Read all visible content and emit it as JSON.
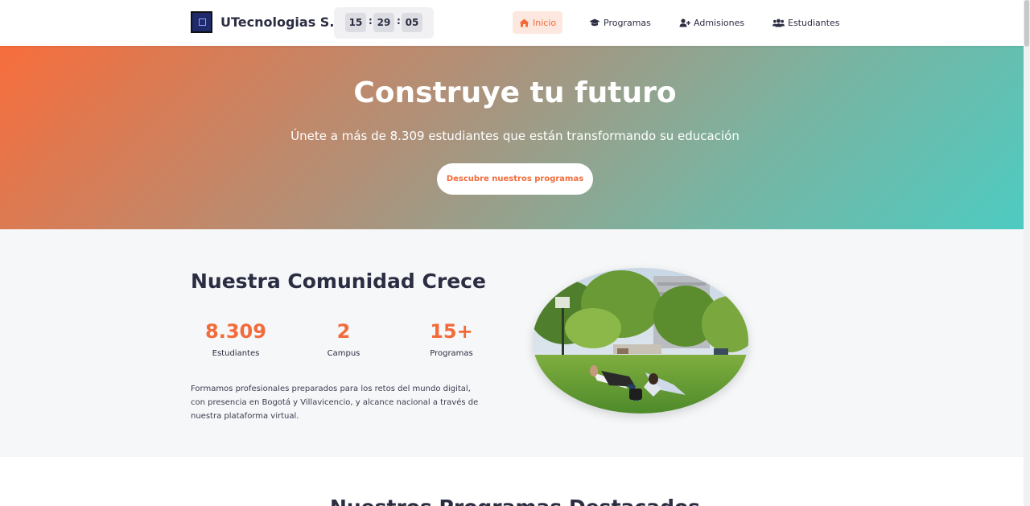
{
  "header": {
    "brand": "UTecnologias S.O",
    "clock": {
      "hours": "15",
      "minutes": "29",
      "seconds": "05",
      "separator": ":"
    },
    "nav": [
      {
        "label": "Inicio",
        "icon": "home-icon",
        "active": true
      },
      {
        "label": "Programas",
        "icon": "graduation-cap-icon",
        "active": false
      },
      {
        "label": "Admisiones",
        "icon": "user-plus-icon",
        "active": false
      },
      {
        "label": "Estudiantes",
        "icon": "users-icon",
        "active": false
      }
    ]
  },
  "hero": {
    "title": "Construye tu futuro",
    "subtitle": "Únete a más de 8.309 estudiantes que están transformando su educación",
    "cta": "Descubre nuestros programas"
  },
  "community": {
    "title": "Nuestra Comunidad Crece",
    "stats": [
      {
        "value": "8.309",
        "label": "Estudiantes"
      },
      {
        "value": "2",
        "label": "Campus"
      },
      {
        "value": "15+",
        "label": "Programas"
      }
    ],
    "description": "Formamos profesionales preparados para los retos del mundo digital, con presencia en Bogotá y Villavicencio, y alcance nacional a través de nuestra plataforma virtual."
  },
  "next_section": {
    "title": "Nuestros Programas Destacados"
  },
  "colors": {
    "accent": "#f26b3a",
    "dark": "#2b2d42",
    "teal": "#4ecbc1"
  }
}
